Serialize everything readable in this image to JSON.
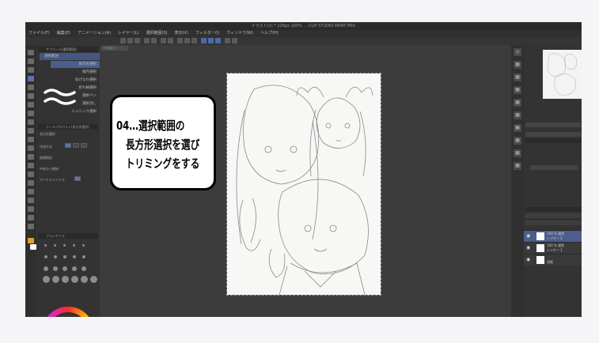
{
  "app": {
    "title": "イラスト(1) * 229px 100% ... CLIP STUDIO PAINT PRO",
    "menu": [
      "ファイル(F)",
      "編集(E)",
      "アニメーション(A)",
      "レイヤー(L)",
      "選択範囲(S)",
      "表示(V)",
      "フィルター(I)",
      "ウィンドウ(W)",
      "ヘルプ(H)"
    ],
    "document_tab": "イラスト"
  },
  "tool_panel": {
    "title": "サブツール[選択範囲]",
    "items": [
      {
        "label": "長方形選択",
        "selected": true
      },
      {
        "label": "楕円選択",
        "selected": false
      },
      {
        "label": "投げなわ選択",
        "selected": false
      },
      {
        "label": "折れ線選択",
        "selected": false
      },
      {
        "label": "選択ペン",
        "selected": false
      },
      {
        "label": "選択消し",
        "selected": false
      },
      {
        "label": "シュリンク選択",
        "selected": false
      }
    ]
  },
  "tool_property": {
    "title": "ツールプロパティ[長方形選択]",
    "tool_name": "長方形選択",
    "rows": [
      "作成方法",
      "縦横指定",
      "中央から開始",
      "アンチエイリアス"
    ]
  },
  "brush_size": {
    "title": "ブラシサイズ"
  },
  "annotation": {
    "text": "04…選択範囲の\n　長方形選択を選び\n　トリミングをする"
  },
  "layers": {
    "rows": [
      {
        "name": "100 % 通常\nレイヤー 2",
        "selected": true
      },
      {
        "name": "100 % 通常\nレイヤー 1",
        "selected": false
      },
      {
        "name": "\n用紙",
        "selected": false
      }
    ]
  },
  "colors": {
    "accent": "#4b5e8d",
    "workspace": "#3c3c3c",
    "panel": "#333333"
  }
}
